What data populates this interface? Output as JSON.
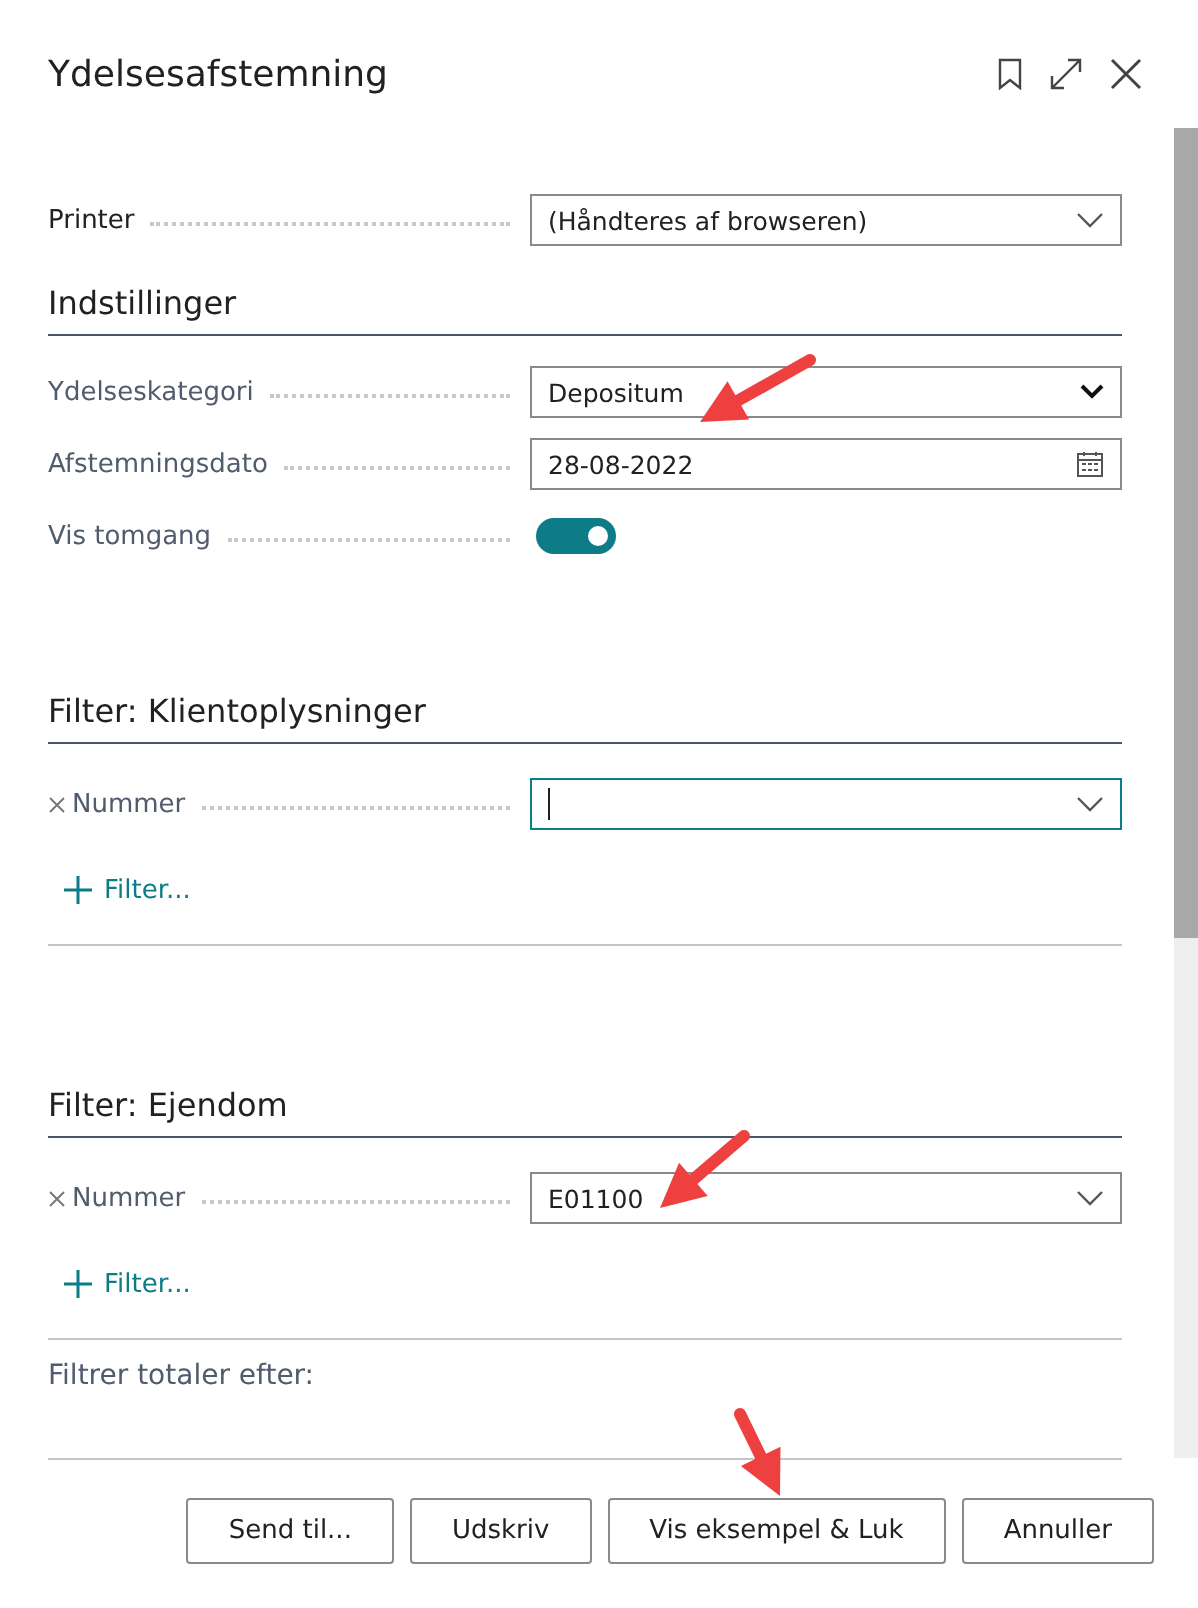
{
  "window": {
    "title": "Ydelsesafstemning"
  },
  "printer": {
    "label": "Printer",
    "value": "(Håndteres af browseren)"
  },
  "settings": {
    "heading": "Indstillinger",
    "fields": [
      {
        "kind": "select",
        "label": "Ydelseskategori",
        "value": "Depositum"
      },
      {
        "kind": "date",
        "label": "Afstemningsdato",
        "value": "28-08-2022"
      },
      {
        "kind": "toggle",
        "label": "Vis tomgang",
        "on": true
      }
    ]
  },
  "filters": [
    {
      "heading": "Filter: Klientoplysninger",
      "fields": [
        {
          "label": "Nummer",
          "focused": true
        }
      ],
      "add_filter": "Filter..."
    },
    {
      "heading": "Filter: Ejendom",
      "fields": [
        {
          "label": "Nummer",
          "value": "E01100",
          "focused": false
        }
      ],
      "add_filter": "Filter..."
    }
  ],
  "totals_label": "Filtrer totaler efter:",
  "buttons": [
    "Send til...",
    "Udskriv",
    "Vis eksempel & Luk",
    "Annuller"
  ]
}
